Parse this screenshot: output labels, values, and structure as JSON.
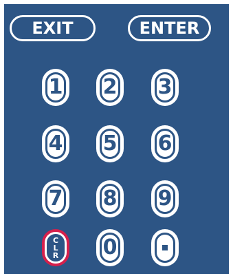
{
  "buttons": {
    "exit": "EXIT",
    "enter": "ENTER"
  },
  "keypad": {
    "keys": [
      "1",
      "2",
      "3",
      "4",
      "5",
      "6",
      "7",
      "8",
      "9"
    ],
    "zero": "0",
    "clear_letters": [
      "C",
      "L",
      "R"
    ]
  },
  "colors": {
    "panel": "#2d5585",
    "key_face": "#ffffff",
    "clear_ring": "#d6204c"
  }
}
